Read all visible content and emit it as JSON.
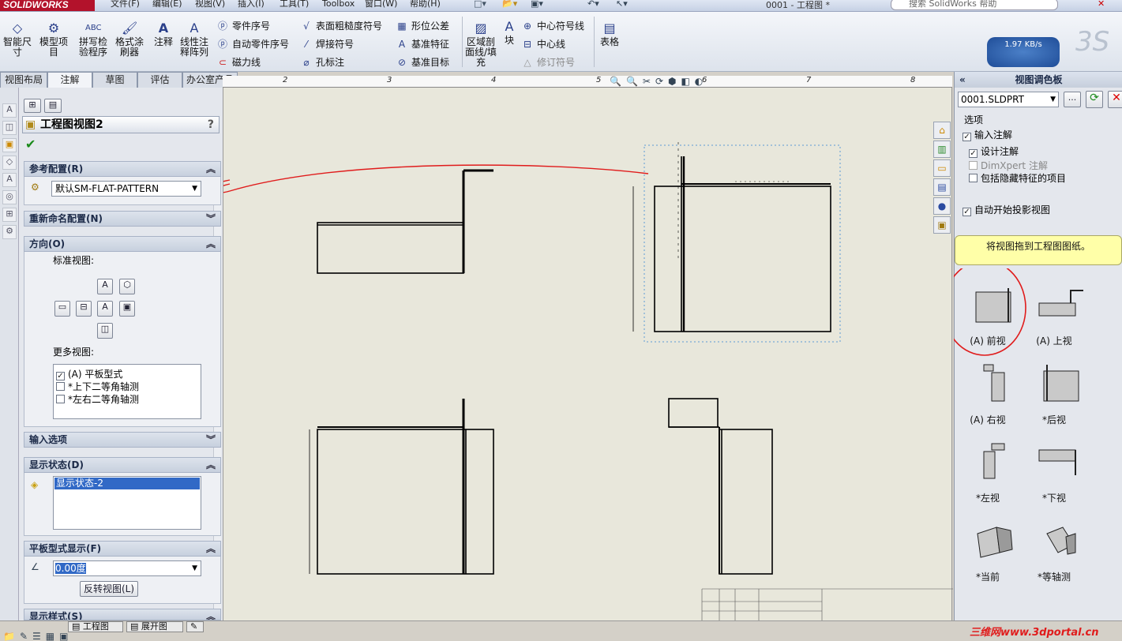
{
  "app": {
    "logo": "SOLIDWORKS",
    "doc_title": "0001 - 工程图 *",
    "help_search_placeholder": "搜索 SolidWorks 帮助"
  },
  "menu": [
    "文件(F)",
    "编辑(E)",
    "视图(V)",
    "插入(I)",
    "工具(T)",
    "Toolbox",
    "窗口(W)",
    "帮助(H)"
  ],
  "toolbar": {
    "big_buttons": [
      "智能尺寸",
      "模型项目",
      "拼写检验程序",
      "格式涂刷器",
      "注释",
      "线性注释阵列",
      "区域剖面线/填充",
      "块",
      "表格"
    ],
    "rows": {
      "col1": [
        "零件序号",
        "自动零件序号",
        "磁力线"
      ],
      "col2": [
        "表面粗糙度符号",
        "焊接符号",
        "孔标注"
      ],
      "col3": [
        "形位公差",
        "基准特征",
        "基准目标"
      ],
      "col4": [
        "中心符号线",
        "中心线",
        "修订符号"
      ]
    },
    "speed": "1.97 KB/s"
  },
  "cm_tabs": [
    "视图布局",
    "注解",
    "草图",
    "评估",
    "办公室产品"
  ],
  "ruler_labels": [
    "2",
    "3",
    "4",
    "5",
    "6",
    "7",
    "8"
  ],
  "pm": {
    "title": "工程图视图2",
    "ref_config": {
      "header": "参考配置(R)",
      "value": "默认SM-FLAT-PATTERN"
    },
    "rename_config": {
      "header": "重新命名配置(N)"
    },
    "orientation": {
      "header": "方向(O)",
      "standard_views_label": "标准视图:",
      "more_views_label": "更多视图:",
      "more_views": [
        {
          "label": "(A) 平板型式",
          "checked": true
        },
        {
          "label": "*上下二等角轴测",
          "checked": false
        },
        {
          "label": "*左右二等角轴测",
          "checked": false
        }
      ]
    },
    "import_options": {
      "header": "输入选项"
    },
    "display_state": {
      "header": "显示状态(D)",
      "item": "显示状态-2"
    },
    "flat_pattern": {
      "header": "平板型式显示(F)",
      "angle": "0.00度",
      "flip_button": "反转视图(L)"
    },
    "display_style": {
      "header": "显示样式(S)"
    }
  },
  "pane": {
    "title": "视图调色板",
    "file": "0001.SLDPRT",
    "options_label": "选项",
    "options": [
      {
        "label": "输入注解",
        "checked": true
      },
      {
        "label": "设计注解",
        "checked": true
      },
      {
        "label": "DimXpert 注解",
        "checked": false,
        "disabled": true
      },
      {
        "label": "包括隐藏特征的项目",
        "checked": false
      }
    ],
    "auto_start": {
      "label": "自动开始投影视图",
      "checked": true
    },
    "drag_message": "将视图拖到工程图图纸。",
    "views": [
      "(A) 前视",
      "(A) 上视",
      "(A) 右视",
      "*后视",
      "*左视",
      "*下视",
      "*当前",
      "*等轴测"
    ]
  },
  "bottom": {
    "tabs": [
      "工程图",
      "展开图"
    ],
    "watermark": "三维网www.3dportal.cn"
  }
}
